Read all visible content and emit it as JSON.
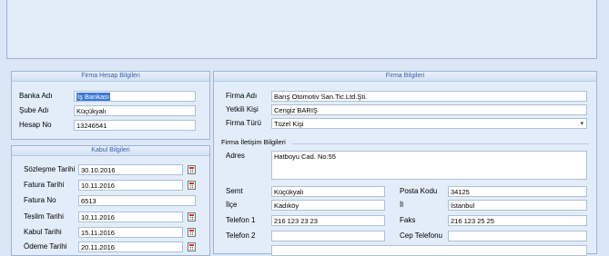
{
  "hesap": {
    "title": "Firma Hesap Bilgileri",
    "banka_label": "Banka Adı",
    "banka_value": "İş Bankası",
    "sube_label": "Şube Adı",
    "sube_value": "Küçükyalı",
    "hesap_label": "Hesap No",
    "hesap_value": "13246541"
  },
  "kabul": {
    "title": "Kabul Bilgileri",
    "rows": [
      {
        "label": "Sözleşme Tarihi",
        "value": "30.10.2016"
      },
      {
        "label": "Fatura Tarihi",
        "value": "10.11.2016"
      },
      {
        "label": "Fatura No",
        "value": "6513"
      },
      {
        "label": "Teslim Tarihi",
        "value": "10.11.2016"
      },
      {
        "label": "Kabul Tarihi",
        "value": "15.11.2016"
      },
      {
        "label": "Ödeme Tarihi",
        "value": "20.11.2016"
      }
    ]
  },
  "firma": {
    "title": "Firma Bilgileri",
    "firma_adi_label": "Firma Adı",
    "firma_adi_value": "Barış Otomotiv San.Tic.Ltd.Şti.",
    "yetkili_label": "Yetkili Kişi",
    "yetkili_value": "Cengiz BARIŞ",
    "turu_label": "Firma Türü",
    "turu_value": "Tüzel Kişi",
    "iletisim_title": "Firma İletişim Bilgileri",
    "adres_label": "Adres",
    "adres_value": "Hatboyu Cad. No:55",
    "semt_label": "Semt",
    "semt_value": "Küçükyalı",
    "posta_label": "Posta Kodu",
    "posta_value": "34125",
    "ilce_label": "İlçe",
    "ilce_value": "Kadıköy",
    "il_label": "İl",
    "il_value": "İstanbul",
    "tel1_label": "Telefon 1",
    "tel1_value": "216 123 23 23",
    "faks_label": "Faks",
    "faks_value": "216 123 25 25",
    "tel2_label": "Telefon 2",
    "tel2_value": "",
    "cep_label": "Cep Telefonu",
    "cep_value": ""
  }
}
